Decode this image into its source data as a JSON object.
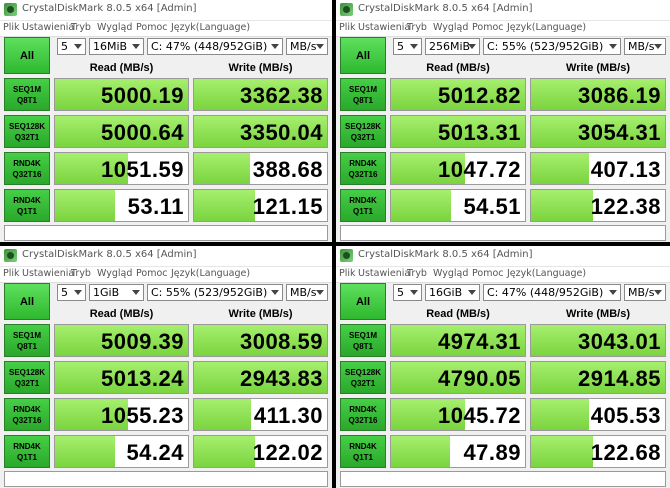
{
  "windows": [
    {
      "title": "CrystalDiskMark 8.0.5 x64 [Admin]",
      "menu": [
        "Plik",
        "Ustawienia",
        "Tryb",
        "Wygląd",
        "Pomoc",
        "Język(Language)"
      ],
      "all_label": "All",
      "count": "5",
      "size": "16MiB",
      "drive": "C: 47% (448/952GiB)",
      "unit": "MB/s",
      "read_header": "Read (MB/s)",
      "write_header": "Write (MB/s)",
      "rows": [
        {
          "label1": "SEQ1M",
          "label2": "Q8T1",
          "read": "5000.19",
          "write": "3362.38",
          "read_fill": 1.0,
          "write_fill": 1.0
        },
        {
          "label1": "SEQ128K",
          "label2": "Q32T1",
          "read": "5000.64",
          "write": "3350.04",
          "read_fill": 1.0,
          "write_fill": 1.0
        },
        {
          "label1": "RND4K",
          "label2": "Q32T16",
          "read": "1051.59",
          "write": "388.68",
          "read_fill": 0.55,
          "write_fill": 0.42
        },
        {
          "label1": "RND4K",
          "label2": "Q1T1",
          "read": "53.11",
          "write": "121.15",
          "read_fill": 0.45,
          "write_fill": 0.46
        }
      ]
    },
    {
      "title": "CrystalDiskMark 8.0.5 x64 [Admin]",
      "menu": [
        "Plik",
        "Ustawienia",
        "Tryb",
        "Wygląd",
        "Pomoc",
        "Język(Language)"
      ],
      "all_label": "All",
      "count": "5",
      "size": "256MiB",
      "drive": "C: 55% (523/952GiB)",
      "unit": "MB/s",
      "read_header": "Read (MB/s)",
      "write_header": "Write (MB/s)",
      "rows": [
        {
          "label1": "SEQ1M",
          "label2": "Q8T1",
          "read": "5012.82",
          "write": "3086.19",
          "read_fill": 1.0,
          "write_fill": 1.0
        },
        {
          "label1": "SEQ128K",
          "label2": "Q32T1",
          "read": "5013.31",
          "write": "3054.31",
          "read_fill": 1.0,
          "write_fill": 1.0
        },
        {
          "label1": "RND4K",
          "label2": "Q32T16",
          "read": "1047.72",
          "write": "407.13",
          "read_fill": 0.55,
          "write_fill": 0.43
        },
        {
          "label1": "RND4K",
          "label2": "Q1T1",
          "read": "54.51",
          "write": "122.38",
          "read_fill": 0.45,
          "write_fill": 0.46
        }
      ]
    },
    {
      "title": "CrystalDiskMark 8.0.5 x64 [Admin]",
      "menu": [
        "Plik",
        "Ustawienia",
        "Tryb",
        "Wygląd",
        "Pomoc",
        "Język(Language)"
      ],
      "all_label": "All",
      "count": "5",
      "size": "1GiB",
      "drive": "C: 55% (523/952GiB)",
      "unit": "MB/s",
      "read_header": "Read (MB/s)",
      "write_header": "Write (MB/s)",
      "rows": [
        {
          "label1": "SEQ1M",
          "label2": "Q8T1",
          "read": "5009.39",
          "write": "3008.59",
          "read_fill": 1.0,
          "write_fill": 1.0
        },
        {
          "label1": "SEQ128K",
          "label2": "Q32T1",
          "read": "5013.24",
          "write": "2943.83",
          "read_fill": 1.0,
          "write_fill": 1.0
        },
        {
          "label1": "RND4K",
          "label2": "Q32T16",
          "read": "1055.23",
          "write": "411.30",
          "read_fill": 0.55,
          "write_fill": 0.43
        },
        {
          "label1": "RND4K",
          "label2": "Q1T1",
          "read": "54.24",
          "write": "122.02",
          "read_fill": 0.45,
          "write_fill": 0.46
        }
      ]
    },
    {
      "title": "CrystalDiskMark 8.0.5 x64 [Admin]",
      "menu": [
        "Plik",
        "Ustawienia",
        "Tryb",
        "Wygląd",
        "Pomoc",
        "Język(Language)"
      ],
      "all_label": "All",
      "count": "5",
      "size": "16GiB",
      "drive": "C: 47% (448/952GiB)",
      "unit": "MB/s",
      "read_header": "Read (MB/s)",
      "write_header": "Write (MB/s)",
      "rows": [
        {
          "label1": "SEQ1M",
          "label2": "Q8T1",
          "read": "4974.31",
          "write": "3043.01",
          "read_fill": 1.0,
          "write_fill": 1.0
        },
        {
          "label1": "SEQ128K",
          "label2": "Q32T1",
          "read": "4790.05",
          "write": "2914.85",
          "read_fill": 1.0,
          "write_fill": 1.0
        },
        {
          "label1": "RND4K",
          "label2": "Q32T16",
          "read": "1045.72",
          "write": "405.53",
          "read_fill": 0.55,
          "write_fill": 0.43
        },
        {
          "label1": "RND4K",
          "label2": "Q1T1",
          "read": "47.89",
          "write": "122.68",
          "read_fill": 0.44,
          "write_fill": 0.46
        }
      ]
    }
  ]
}
